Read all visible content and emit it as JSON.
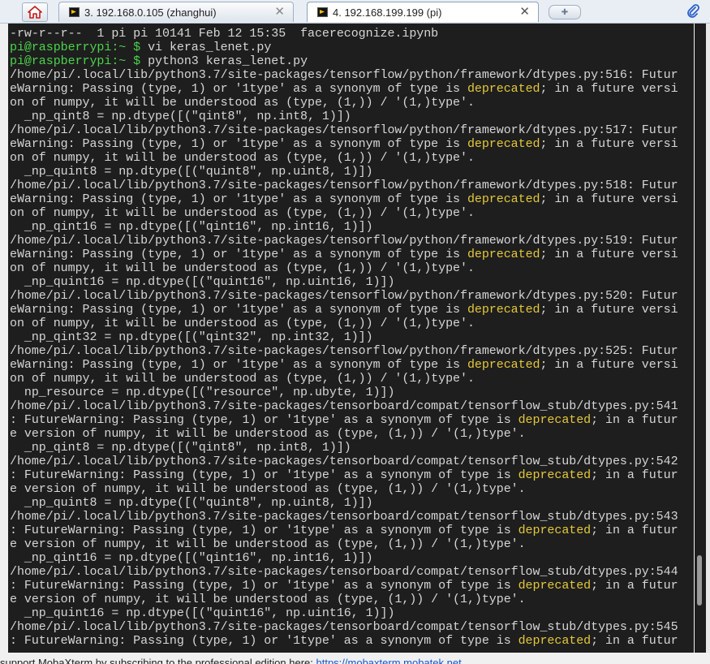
{
  "tabs": [
    {
      "label": "3. 192.168.0.105 (zhanghui)",
      "active": false
    },
    {
      "label": "4. 192.168.199.199 (pi)",
      "active": true
    }
  ],
  "icons": {
    "home": "home-icon",
    "terminal": "terminal-icon",
    "close": "close-icon",
    "new_tab": "new-tab-icon",
    "attach": "paperclip-icon"
  },
  "colors": {
    "terminal_bg": "#1e1e1e",
    "text": "#d6d6d6",
    "prompt": "#4bd34b",
    "highlight": "#e4c83a"
  },
  "terminal": {
    "lines": [
      [
        {
          "t": "-rw-r--r--  1 pi pi 10141 Feb 12 15:35  facerecognize.ipynb"
        }
      ],
      [
        {
          "t": "pi@raspberrypi:~ $",
          "c": "prompt"
        },
        {
          "t": " vi keras_lenet.py"
        }
      ],
      [
        {
          "t": "pi@raspberrypi:~ $",
          "c": "prompt"
        },
        {
          "t": " python3 keras_lenet.py"
        }
      ],
      [
        {
          "t": "/home/pi/.local/lib/python3.7/site-packages/tensorflow/python/framework/dtypes.py:516: Futur"
        }
      ],
      [
        {
          "t": "eWarning: Passing (type, 1) or '1type' as a synonym of type is "
        },
        {
          "t": "deprecated",
          "c": "hl"
        },
        {
          "t": "; in a future versi"
        }
      ],
      [
        {
          "t": "on of numpy, it will be understood as (type, (1,)) / '(1,)type'."
        }
      ],
      [
        {
          "t": "  _np_qint8 = np.dtype([(\"qint8\", np.int8, 1)])"
        }
      ],
      [
        {
          "t": "/home/pi/.local/lib/python3.7/site-packages/tensorflow/python/framework/dtypes.py:517: Futur"
        }
      ],
      [
        {
          "t": "eWarning: Passing (type, 1) or '1type' as a synonym of type is "
        },
        {
          "t": "deprecated",
          "c": "hl"
        },
        {
          "t": "; in a future versi"
        }
      ],
      [
        {
          "t": "on of numpy, it will be understood as (type, (1,)) / '(1,)type'."
        }
      ],
      [
        {
          "t": "  _np_quint8 = np.dtype([(\"quint8\", np.uint8, 1)])"
        }
      ],
      [
        {
          "t": "/home/pi/.local/lib/python3.7/site-packages/tensorflow/python/framework/dtypes.py:518: Futur"
        }
      ],
      [
        {
          "t": "eWarning: Passing (type, 1) or '1type' as a synonym of type is "
        },
        {
          "t": "deprecated",
          "c": "hl"
        },
        {
          "t": "; in a future versi"
        }
      ],
      [
        {
          "t": "on of numpy, it will be understood as (type, (1,)) / '(1,)type'."
        }
      ],
      [
        {
          "t": "  _np_qint16 = np.dtype([(\"qint16\", np.int16, 1)])"
        }
      ],
      [
        {
          "t": "/home/pi/.local/lib/python3.7/site-packages/tensorflow/python/framework/dtypes.py:519: Futur"
        }
      ],
      [
        {
          "t": "eWarning: Passing (type, 1) or '1type' as a synonym of type is "
        },
        {
          "t": "deprecated",
          "c": "hl"
        },
        {
          "t": "; in a future versi"
        }
      ],
      [
        {
          "t": "on of numpy, it will be understood as (type, (1,)) / '(1,)type'."
        }
      ],
      [
        {
          "t": "  _np_quint16 = np.dtype([(\"quint16\", np.uint16, 1)])"
        }
      ],
      [
        {
          "t": "/home/pi/.local/lib/python3.7/site-packages/tensorflow/python/framework/dtypes.py:520: Futur"
        }
      ],
      [
        {
          "t": "eWarning: Passing (type, 1) or '1type' as a synonym of type is "
        },
        {
          "t": "deprecated",
          "c": "hl"
        },
        {
          "t": "; in a future versi"
        }
      ],
      [
        {
          "t": "on of numpy, it will be understood as (type, (1,)) / '(1,)type'."
        }
      ],
      [
        {
          "t": "  _np_qint32 = np.dtype([(\"qint32\", np.int32, 1)])"
        }
      ],
      [
        {
          "t": "/home/pi/.local/lib/python3.7/site-packages/tensorflow/python/framework/dtypes.py:525: Futur"
        }
      ],
      [
        {
          "t": "eWarning: Passing (type, 1) or '1type' as a synonym of type is "
        },
        {
          "t": "deprecated",
          "c": "hl"
        },
        {
          "t": "; in a future versi"
        }
      ],
      [
        {
          "t": "on of numpy, it will be understood as (type, (1,)) / '(1,)type'."
        }
      ],
      [
        {
          "t": "  np_resource = np.dtype([(\"resource\", np.ubyte, 1)])"
        }
      ],
      [
        {
          "t": "/home/pi/.local/lib/python3.7/site-packages/tensorboard/compat/tensorflow_stub/dtypes.py:541"
        }
      ],
      [
        {
          "t": ": FutureWarning: Passing (type, 1) or '1type' as a synonym of type is "
        },
        {
          "t": "deprecated",
          "c": "hl"
        },
        {
          "t": "; in a futur"
        }
      ],
      [
        {
          "t": "e version of numpy, it will be understood as (type, (1,)) / '(1,)type'."
        }
      ],
      [
        {
          "t": "  _np_qint8 = np.dtype([(\"qint8\", np.int8, 1)])"
        }
      ],
      [
        {
          "t": "/home/pi/.local/lib/python3.7/site-packages/tensorboard/compat/tensorflow_stub/dtypes.py:542"
        }
      ],
      [
        {
          "t": ": FutureWarning: Passing (type, 1) or '1type' as a synonym of type is "
        },
        {
          "t": "deprecated",
          "c": "hl"
        },
        {
          "t": "; in a futur"
        }
      ],
      [
        {
          "t": "e version of numpy, it will be understood as (type, (1,)) / '(1,)type'."
        }
      ],
      [
        {
          "t": "  _np_quint8 = np.dtype([(\"quint8\", np.uint8, 1)])"
        }
      ],
      [
        {
          "t": "/home/pi/.local/lib/python3.7/site-packages/tensorboard/compat/tensorflow_stub/dtypes.py:543"
        }
      ],
      [
        {
          "t": ": FutureWarning: Passing (type, 1) or '1type' as a synonym of type is "
        },
        {
          "t": "deprecated",
          "c": "hl"
        },
        {
          "t": "; in a futur"
        }
      ],
      [
        {
          "t": "e version of numpy, it will be understood as (type, (1,)) / '(1,)type'."
        }
      ],
      [
        {
          "t": "  _np_qint16 = np.dtype([(\"qint16\", np.int16, 1)])"
        }
      ],
      [
        {
          "t": "/home/pi/.local/lib/python3.7/site-packages/tensorboard/compat/tensorflow_stub/dtypes.py:544"
        }
      ],
      [
        {
          "t": ": FutureWarning: Passing (type, 1) or '1type' as a synonym of type is "
        },
        {
          "t": "deprecated",
          "c": "hl"
        },
        {
          "t": "; in a futur"
        }
      ],
      [
        {
          "t": "e version of numpy, it will be understood as (type, (1,)) / '(1,)type'."
        }
      ],
      [
        {
          "t": "  _np_quint16 = np.dtype([(\"quint16\", np.uint16, 1)])"
        }
      ],
      [
        {
          "t": "/home/pi/.local/lib/python3.7/site-packages/tensorboard/compat/tensorflow_stub/dtypes.py:545"
        }
      ],
      [
        {
          "t": ": FutureWarning: Passing (type, 1) or '1type' as a synonym of type is "
        },
        {
          "t": "deprecated",
          "c": "hl"
        },
        {
          "t": "; in a futur"
        }
      ]
    ]
  },
  "status_bar": {
    "text": "support MobaXterm by subscribing to the professional edition here: ",
    "link": "https://mobaxterm.mobatek.net"
  }
}
